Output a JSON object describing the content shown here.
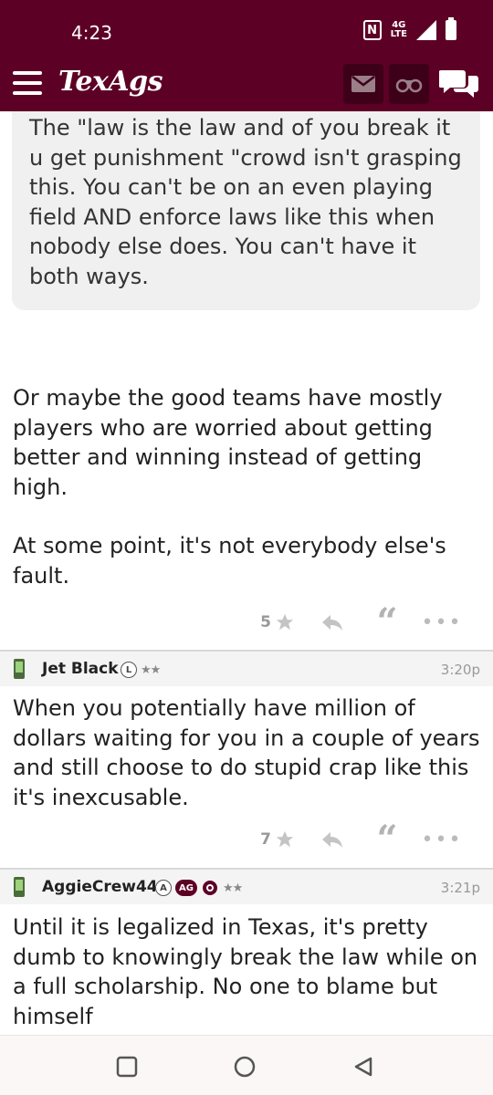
{
  "status_bar": {
    "time": "4:23",
    "network": "4G\nLTE",
    "nfc": "N"
  },
  "app": {
    "logo": "TexAgs",
    "icons": [
      "menu-icon",
      "mail-icon",
      "binoculars-icon",
      "chat-icon"
    ]
  },
  "quoted_post": {
    "text": "The \"law is the law and of you break it u get punishment \"crowd isn't grasping this. You can't be on an even playing field AND enforce laws like this when nobody else does. You can't have it both ways."
  },
  "posts": [
    {
      "paragraphs": [
        "Or maybe the good teams have mostly players who are worried about getting better and winning instead of getting high.",
        "At some point, it's not everybody else's fault."
      ],
      "rating": "5"
    },
    {
      "user": "Jet Black",
      "badge": "L",
      "stars": "★★",
      "time": "3:20p",
      "paragraphs": [
        "When you potentially have million of dollars waiting for you in a couple of years and still choose to do stupid crap like this it's inexcusable."
      ],
      "rating": "7"
    },
    {
      "user": "AggieCrew44",
      "badge": "A",
      "badge2": "AG",
      "stars": "★★",
      "time": "3:21p",
      "paragraphs": [
        "Until it is legalized in Texas, it's pretty dumb to knowingly break the law while on a full scholarship. No one to blame but himself"
      ]
    }
  ],
  "colors": {
    "brand": "#5d0025",
    "brand_dark": "#3d0018",
    "quote_bg": "#f0f0f0",
    "icon_gray": "#aaaaaa"
  }
}
